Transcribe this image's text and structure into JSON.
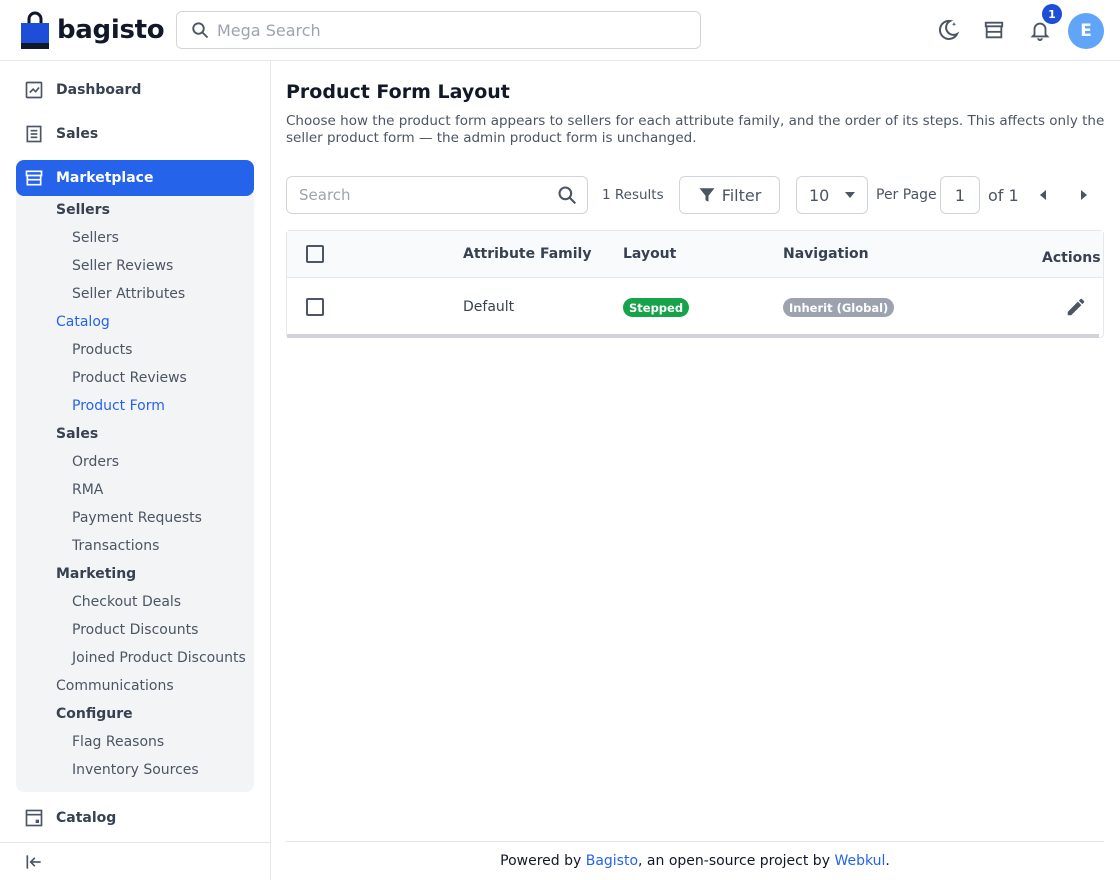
{
  "header": {
    "logo_text": "bagisto",
    "search_placeholder": "Mega Search",
    "notification_count": "1",
    "avatar_initial": "E"
  },
  "sidebar": {
    "dashboard": "Dashboard",
    "sales": "Sales",
    "marketplace": "Marketplace",
    "catalog": "Catalog",
    "groups": {
      "sellers": "Sellers",
      "catalog": "Catalog",
      "sales": "Sales",
      "marketing": "Marketing",
      "communications": "Communications",
      "configure": "Configure"
    },
    "items": {
      "sellers": "Sellers",
      "seller_reviews": "Seller Reviews",
      "seller_attributes": "Seller Attributes",
      "products": "Products",
      "product_reviews": "Product Reviews",
      "product_form": "Product Form",
      "orders": "Orders",
      "rma": "RMA",
      "payment_requests": "Payment Requests",
      "transactions": "Transactions",
      "checkout_deals": "Checkout Deals",
      "product_discounts": "Product Discounts",
      "joined_product_discounts": "Joined Product Discounts",
      "flag_reasons": "Flag Reasons",
      "inventory_sources": "Inventory Sources"
    }
  },
  "main": {
    "title": "Product Form Layout",
    "description": "Choose how the product form appears to sellers for each attribute family, and the order of its steps. This affects only the seller product form — the admin product form is unchanged.",
    "toolbar": {
      "search_placeholder": "Search",
      "results": "1 Results",
      "filter_label": "Filter",
      "per_page_value": "10",
      "per_page_label": "Per Page",
      "page": "1",
      "of_label": "of 1"
    },
    "table": {
      "columns": {
        "attribute_family": "Attribute Family",
        "layout": "Layout",
        "navigation": "Navigation",
        "actions": "Actions"
      },
      "rows": [
        {
          "attribute_family": "Default",
          "layout": "Stepped",
          "navigation": "Inherit (Global)"
        }
      ]
    }
  },
  "footer": {
    "prefix": "Powered by ",
    "bagisto_link": "Bagisto",
    "middle": ", an open-source project by ",
    "webkul_link": "Webkul",
    "suffix": "."
  },
  "colors": {
    "accent": "#2563eb",
    "badge_green": "#16a34a",
    "badge_gray": "#9ca3af"
  }
}
